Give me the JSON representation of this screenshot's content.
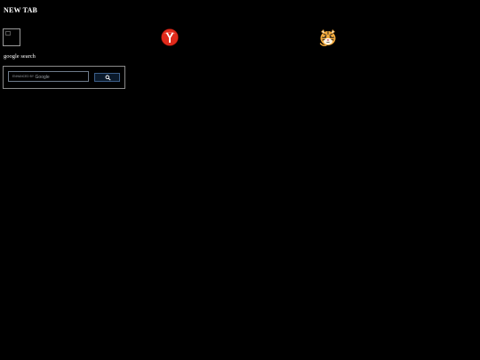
{
  "page": {
    "title": "NEW TAB"
  },
  "shortcuts": [
    {
      "icon": "broken-image-icon"
    },
    {
      "icon": "yandex-browser-icon"
    },
    {
      "icon": "tiger-icon"
    }
  ],
  "search": {
    "caption": "google search",
    "placeholder_prefix": "ENHANCED BY",
    "placeholder_brand": "Google",
    "button_icon": "search-icon"
  },
  "colors": {
    "background": "#000000",
    "text": "#ffffff",
    "button_fill": "#0b1a2b",
    "button_border": "#3c5f8a",
    "yandex_red": "#e02a1b"
  }
}
